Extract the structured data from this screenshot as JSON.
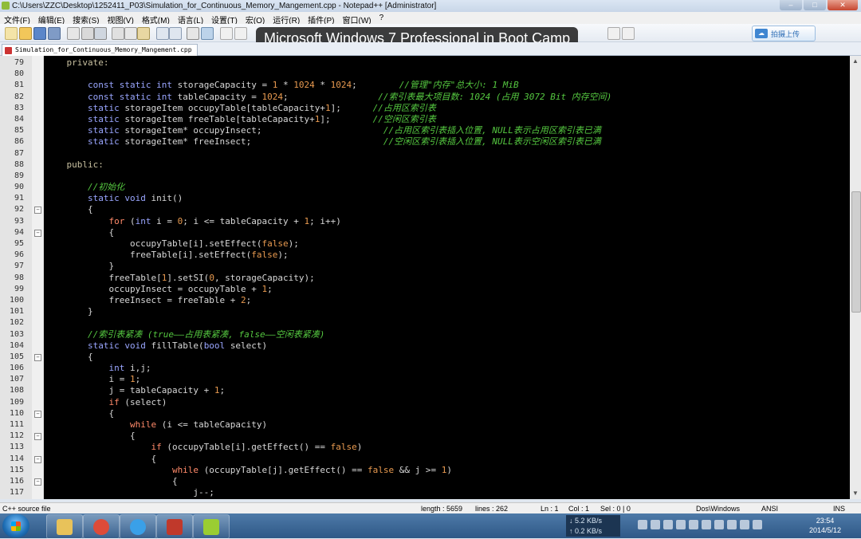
{
  "window": {
    "title": "C:\\Users\\ZZC\\Desktop\\1252411_P03\\Simulation_for_Continuous_Memory_Mangement.cpp - Notepad++ [Administrator]",
    "controls": {
      "minimize": "–",
      "maximize": "□",
      "close": "✕"
    }
  },
  "menu": [
    "文件(F)",
    "编辑(E)",
    "搜索(S)",
    "视图(V)",
    "格式(M)",
    "语言(L)",
    "设置(T)",
    "宏(O)",
    "运行(R)",
    "插件(P)",
    "窗口(W)",
    "?"
  ],
  "overlay_text": "Microsoft Windows 7 Professional in Boot Camp",
  "share_button": "拍摄上传",
  "tab": {
    "label": "Simulation_for_Continuous_Memory_Mangement.cpp"
  },
  "code_lines": [
    {
      "n": "79",
      "fold": "",
      "tokens": [
        [
          "kw",
          "    private:"
        ]
      ]
    },
    {
      "n": "80",
      "fold": "",
      "tokens": []
    },
    {
      "n": "81",
      "fold": "",
      "tokens": [
        [
          "kw2",
          "        const static int "
        ],
        [
          "id",
          "storageCapacity = "
        ],
        [
          "num",
          "1"
        ],
        [
          "op",
          " * "
        ],
        [
          "num",
          "1024"
        ],
        [
          "op",
          " * "
        ],
        [
          "num",
          "1024"
        ],
        [
          "op",
          ";"
        ],
        [
          "id",
          "        "
        ],
        [
          "cm",
          "//管理\"内存\"总大小: 1 MiB"
        ]
      ]
    },
    {
      "n": "82",
      "fold": "",
      "tokens": [
        [
          "kw2",
          "        const static int "
        ],
        [
          "id",
          "tableCapacity = "
        ],
        [
          "num",
          "1024"
        ],
        [
          "op",
          ";"
        ],
        [
          "id",
          "                 "
        ],
        [
          "cm",
          "//索引表最大项目数: 1024 (占用 3072 Bit 内存空间)"
        ]
      ]
    },
    {
      "n": "83",
      "fold": "",
      "tokens": [
        [
          "kw2",
          "        static "
        ],
        [
          "id",
          "storageItem occupyTable[tableCapacity+"
        ],
        [
          "num",
          "1"
        ],
        [
          "id",
          "];"
        ],
        [
          "id",
          "      "
        ],
        [
          "cm",
          "//占用区索引表"
        ]
      ]
    },
    {
      "n": "84",
      "fold": "",
      "tokens": [
        [
          "kw2",
          "        static "
        ],
        [
          "id",
          "storageItem freeTable[tableCapacity+"
        ],
        [
          "num",
          "1"
        ],
        [
          "id",
          "];"
        ],
        [
          "id",
          "        "
        ],
        [
          "cm",
          "//空闲区索引表"
        ]
      ]
    },
    {
      "n": "85",
      "fold": "",
      "tokens": [
        [
          "kw2",
          "        static "
        ],
        [
          "id",
          "storageItem* occupyInsect;"
        ],
        [
          "id",
          "                       "
        ],
        [
          "cm",
          "//占用区索引表插入位置, NULL表示占用区索引表已满"
        ]
      ]
    },
    {
      "n": "86",
      "fold": "",
      "tokens": [
        [
          "kw2",
          "        static "
        ],
        [
          "id",
          "storageItem* freeInsect;"
        ],
        [
          "id",
          "                         "
        ],
        [
          "cm",
          "//空闲区索引表插入位置, NULL表示空闲区索引表已满"
        ]
      ]
    },
    {
      "n": "87",
      "fold": "",
      "tokens": []
    },
    {
      "n": "88",
      "fold": "",
      "tokens": [
        [
          "kw",
          "    public:"
        ]
      ]
    },
    {
      "n": "89",
      "fold": "",
      "tokens": []
    },
    {
      "n": "90",
      "fold": "",
      "tokens": [
        [
          "cm",
          "        //初始化"
        ]
      ]
    },
    {
      "n": "91",
      "fold": "",
      "tokens": [
        [
          "kw2",
          "        static void "
        ],
        [
          "id",
          "init()"
        ]
      ]
    },
    {
      "n": "92",
      "fold": "−",
      "tokens": [
        [
          "id",
          "        {"
        ]
      ]
    },
    {
      "n": "93",
      "fold": "",
      "tokens": [
        [
          "ctl",
          "            for "
        ],
        [
          "id",
          "("
        ],
        [
          "kw2",
          "int "
        ],
        [
          "id",
          "i = "
        ],
        [
          "num",
          "0"
        ],
        [
          "id",
          "; i <= tableCapacity + "
        ],
        [
          "num",
          "1"
        ],
        [
          "id",
          "; i++)"
        ]
      ]
    },
    {
      "n": "94",
      "fold": "−",
      "tokens": [
        [
          "id",
          "            {"
        ]
      ]
    },
    {
      "n": "95",
      "fold": "",
      "tokens": [
        [
          "id",
          "                occupyTable[i].setEffect("
        ],
        [
          "fl",
          "false"
        ],
        [
          "id",
          ");"
        ]
      ]
    },
    {
      "n": "96",
      "fold": "",
      "tokens": [
        [
          "id",
          "                freeTable[i].setEffect("
        ],
        [
          "fl",
          "false"
        ],
        [
          "id",
          ");"
        ]
      ]
    },
    {
      "n": "97",
      "fold": "",
      "tokens": [
        [
          "id",
          "            }"
        ]
      ]
    },
    {
      "n": "98",
      "fold": "",
      "tokens": [
        [
          "id",
          "            freeTable["
        ],
        [
          "num",
          "1"
        ],
        [
          "id",
          "].setSI("
        ],
        [
          "num",
          "0"
        ],
        [
          "id",
          ", storageCapacity);"
        ]
      ]
    },
    {
      "n": "99",
      "fold": "",
      "tokens": [
        [
          "id",
          "            occupyInsect = occupyTable + "
        ],
        [
          "num",
          "1"
        ],
        [
          "id",
          ";"
        ]
      ]
    },
    {
      "n": "100",
      "fold": "",
      "tokens": [
        [
          "id",
          "            freeInsect = freeTable + "
        ],
        [
          "num",
          "2"
        ],
        [
          "id",
          ";"
        ]
      ]
    },
    {
      "n": "101",
      "fold": "",
      "tokens": [
        [
          "id",
          "        }"
        ]
      ]
    },
    {
      "n": "102",
      "fold": "",
      "tokens": []
    },
    {
      "n": "103",
      "fold": "",
      "tokens": [
        [
          "cm",
          "        //索引表紧凑 (true——占用表紧凑, false——空闲表紧凑)"
        ]
      ]
    },
    {
      "n": "104",
      "fold": "",
      "tokens": [
        [
          "kw2",
          "        static void "
        ],
        [
          "id",
          "fillTable("
        ],
        [
          "kw2",
          "bool "
        ],
        [
          "id",
          "select)"
        ]
      ]
    },
    {
      "n": "105",
      "fold": "−",
      "tokens": [
        [
          "id",
          "        {"
        ]
      ]
    },
    {
      "n": "106",
      "fold": "",
      "tokens": [
        [
          "kw2",
          "            int "
        ],
        [
          "id",
          "i,j;"
        ]
      ]
    },
    {
      "n": "107",
      "fold": "",
      "tokens": [
        [
          "id",
          "            i = "
        ],
        [
          "num",
          "1"
        ],
        [
          "id",
          ";"
        ]
      ]
    },
    {
      "n": "108",
      "fold": "",
      "tokens": [
        [
          "id",
          "            j = tableCapacity + "
        ],
        [
          "num",
          "1"
        ],
        [
          "id",
          ";"
        ]
      ]
    },
    {
      "n": "109",
      "fold": "",
      "tokens": [
        [
          "ctl",
          "            if "
        ],
        [
          "id",
          "(select)"
        ]
      ]
    },
    {
      "n": "110",
      "fold": "−",
      "tokens": [
        [
          "id",
          "            {"
        ]
      ]
    },
    {
      "n": "111",
      "fold": "",
      "tokens": [
        [
          "ctl",
          "                while "
        ],
        [
          "id",
          "(i <= tableCapacity)"
        ]
      ]
    },
    {
      "n": "112",
      "fold": "−",
      "tokens": [
        [
          "id",
          "                {"
        ]
      ]
    },
    {
      "n": "113",
      "fold": "",
      "tokens": [
        [
          "ctl",
          "                    if "
        ],
        [
          "id",
          "(occupyTable[i].getEffect() == "
        ],
        [
          "fl",
          "false"
        ],
        [
          "id",
          ")"
        ]
      ]
    },
    {
      "n": "114",
      "fold": "−",
      "tokens": [
        [
          "id",
          "                    {"
        ]
      ]
    },
    {
      "n": "115",
      "fold": "",
      "tokens": [
        [
          "ctl",
          "                        while "
        ],
        [
          "id",
          "(occupyTable[j].getEffect() == "
        ],
        [
          "fl",
          "false"
        ],
        [
          "id",
          " && j >= "
        ],
        [
          "num",
          "1"
        ],
        [
          "id",
          ")"
        ]
      ]
    },
    {
      "n": "116",
      "fold": "−",
      "tokens": [
        [
          "id",
          "                        {"
        ]
      ]
    },
    {
      "n": "117",
      "fold": "",
      "tokens": [
        [
          "id",
          "                            j--;"
        ]
      ]
    }
  ],
  "status": {
    "file_type": "C++ source file",
    "length": "length : 5659",
    "lines": "lines : 262",
    "ln": "Ln : 1",
    "col": "Col : 1",
    "sel": "Sel : 0 | 0",
    "eol": "Dos\\Windows",
    "encoding": "ANSI",
    "mode": "INS"
  },
  "taskbar": {
    "apps": [
      {
        "name": "explorer",
        "color": "#e8c25a"
      },
      {
        "name": "chrome",
        "color": "#dd4b39"
      },
      {
        "name": "ie",
        "color": "#3aa0e8"
      },
      {
        "name": "cpp-ide",
        "color": "#c0392b"
      },
      {
        "name": "notepadpp",
        "color": "#9acd32"
      }
    ],
    "net_down": "5.2 KB/s",
    "net_up": "0.2 KB/s",
    "clock_time": "23:54",
    "clock_date": "2014/5/12"
  }
}
